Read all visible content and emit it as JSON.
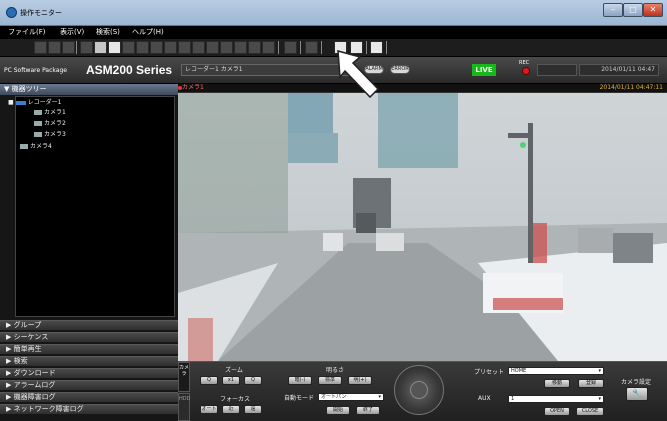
{
  "window": {
    "title": "操作モニター",
    "icon": "camera-app-icon",
    "min": "–",
    "max": "□",
    "close": "✕"
  },
  "menu": [
    "ファイル(F)",
    "表示(V)",
    "検索(S)",
    "ヘルプ(H)"
  ],
  "brand": {
    "package": "PC Software Package",
    "model": "ASM200 Series"
  },
  "camera_selector": "レコーダー1 カメラ1",
  "pills": {
    "alarm": "ALARM",
    "error": "ERROR"
  },
  "live": "LIVE",
  "rec_label": "REC",
  "datetime": "2014/01/11 04:47",
  "sidebar": {
    "tree_title": "機器ツリー",
    "recorder": "レコーダー1",
    "cameras": [
      "カメラ1",
      "カメラ2",
      "カメラ3"
    ],
    "extra_camera": "カメラ4",
    "sections": [
      "グループ",
      "シーケンス",
      "簡単再生",
      "検索",
      "ダウンロード",
      "アラームログ",
      "機器障害ログ",
      "ネットワーク障害ログ"
    ]
  },
  "video": {
    "camera": "カメラ1",
    "timestamp": "2014/01/11 04:47:11"
  },
  "controls": {
    "camera_tab": "カメラ",
    "hdd_tab": "HDD",
    "zoom": "ズーム",
    "zoom_buttons": [
      "Q",
      "x1",
      "Q"
    ],
    "focus": "フォーカス",
    "focus_buttons": [
      "オート",
      "近",
      "遠"
    ],
    "brightness": "明るさ",
    "brightness_buttons": [
      "暗(-)",
      "標準",
      "明(+)"
    ],
    "auto_mode": "自動モード",
    "auto_mode_value": "オートパン",
    "auto_buttons": [
      "開始",
      "終了"
    ],
    "preset": "プリセット",
    "preset_value": "HOME",
    "preset_buttons": [
      "移動",
      "登録"
    ],
    "aux": "AUX",
    "aux_value": "1",
    "aux_buttons": [
      "OPEN",
      "CLOSE"
    ],
    "camera_settings": "カメラ設定"
  }
}
